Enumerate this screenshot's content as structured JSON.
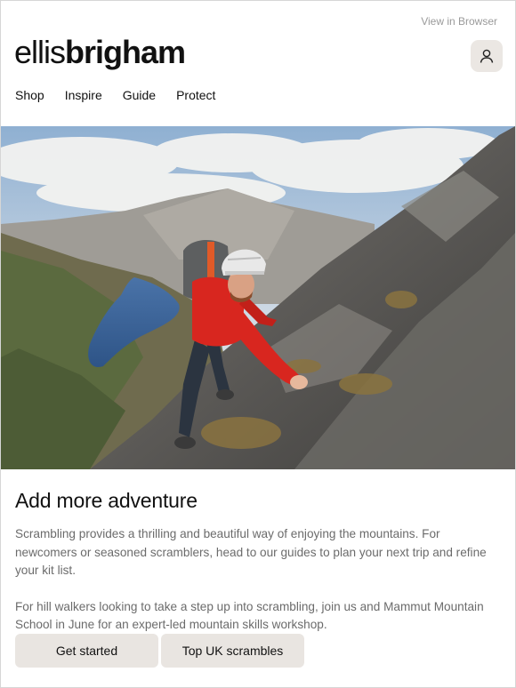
{
  "header": {
    "view_in_browser": "View in Browser",
    "logo_light": "ellis",
    "logo_bold": "brigham",
    "account_icon": "user-icon"
  },
  "nav": {
    "items": [
      {
        "label": "Shop"
      },
      {
        "label": "Inspire"
      },
      {
        "label": "Guide"
      },
      {
        "label": "Protect"
      }
    ]
  },
  "hero": {
    "subject": "climber-scrambling-on-rock-ridge-above-lake"
  },
  "article": {
    "title": "Add more adventure",
    "paragraph_1": "Scrambling provides a thrilling and beautiful way of enjoying the mountains. For newcomers or seasoned scramblers, head to our guides to plan your next trip and refine your kit list.",
    "paragraph_2": "For hill walkers looking to take a step up into scrambling, join us and Mammut Mountain School in June for an expert-led mountain skills workshop."
  },
  "buttons": {
    "get_started": "Get started",
    "top_uk_scrambles": "Top UK scrambles"
  },
  "colors": {
    "button_bg": "#e9e5e1",
    "body_text": "#6b6b6b",
    "jacket_red": "#d8261f"
  }
}
